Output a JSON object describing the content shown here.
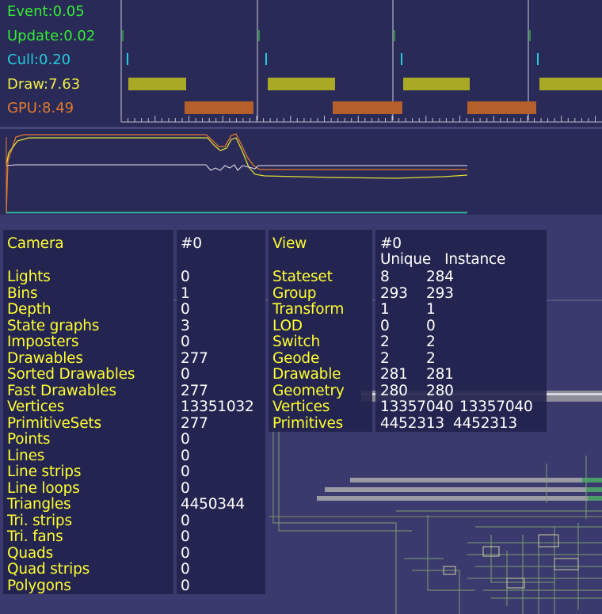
{
  "timing": {
    "event": {
      "label": "Event:0.05",
      "color": "#33ee33"
    },
    "update": {
      "label": "Update:0.02",
      "color": "#33ee33"
    },
    "cull": {
      "label": "Cull:0.20",
      "color": "#22ccdd"
    },
    "draw": {
      "label": "Draw:7.63",
      "color": "#eeee44"
    },
    "gpu": {
      "label": "GPU:8.49",
      "color": "#e07a2c"
    },
    "draw_bar_color": "#a9a926",
    "gpu_bar_color": "#b55f2a"
  },
  "camera_stats": {
    "header": {
      "label": "Camera",
      "value": "#0"
    },
    "rows": [
      {
        "label": "Lights",
        "value": "0"
      },
      {
        "label": "Bins",
        "value": "1"
      },
      {
        "label": "Depth",
        "value": "0"
      },
      {
        "label": "State graphs",
        "value": "3"
      },
      {
        "label": "Imposters",
        "value": "0"
      },
      {
        "label": "Drawables",
        "value": "277"
      },
      {
        "label": "Sorted Drawables",
        "value": "0"
      },
      {
        "label": "Fast Drawables",
        "value": "277"
      },
      {
        "label": "Vertices",
        "value": "13351032"
      },
      {
        "label": "PrimitiveSets",
        "value": "277"
      },
      {
        "label": "Points",
        "value": "0"
      },
      {
        "label": "Lines",
        "value": "0"
      },
      {
        "label": "Line strips",
        "value": "0"
      },
      {
        "label": "Line loops",
        "value": "0"
      },
      {
        "label": "Triangles",
        "value": "4450344"
      },
      {
        "label": "Tri. strips",
        "value": "0"
      },
      {
        "label": "Tri. fans",
        "value": "0"
      },
      {
        "label": "Quads",
        "value": "0"
      },
      {
        "label": "Quad strips",
        "value": "0"
      },
      {
        "label": "Polygons",
        "value": "0"
      }
    ]
  },
  "view_stats": {
    "header": {
      "label": "View",
      "value": "#0"
    },
    "subheader": "Unique   Instance",
    "rows": [
      {
        "label": "Stateset",
        "unique": "8",
        "instance": "284"
      },
      {
        "label": "Group",
        "unique": "293",
        "instance": "293"
      },
      {
        "label": "Transform",
        "unique": "1",
        "instance": "1"
      },
      {
        "label": "LOD",
        "unique": "0",
        "instance": "0"
      },
      {
        "label": "Switch",
        "unique": "2",
        "instance": "2"
      },
      {
        "label": "Geode",
        "unique": "2",
        "instance": "2"
      },
      {
        "label": "Drawable",
        "unique": "281",
        "instance": "281"
      },
      {
        "label": "Geometry",
        "unique": "280",
        "instance": "280"
      },
      {
        "label": "Vertices",
        "unique": "13357040",
        "instance": "13357040"
      },
      {
        "label": "Primitives",
        "unique": "4452313",
        "instance": "4452313"
      }
    ]
  }
}
